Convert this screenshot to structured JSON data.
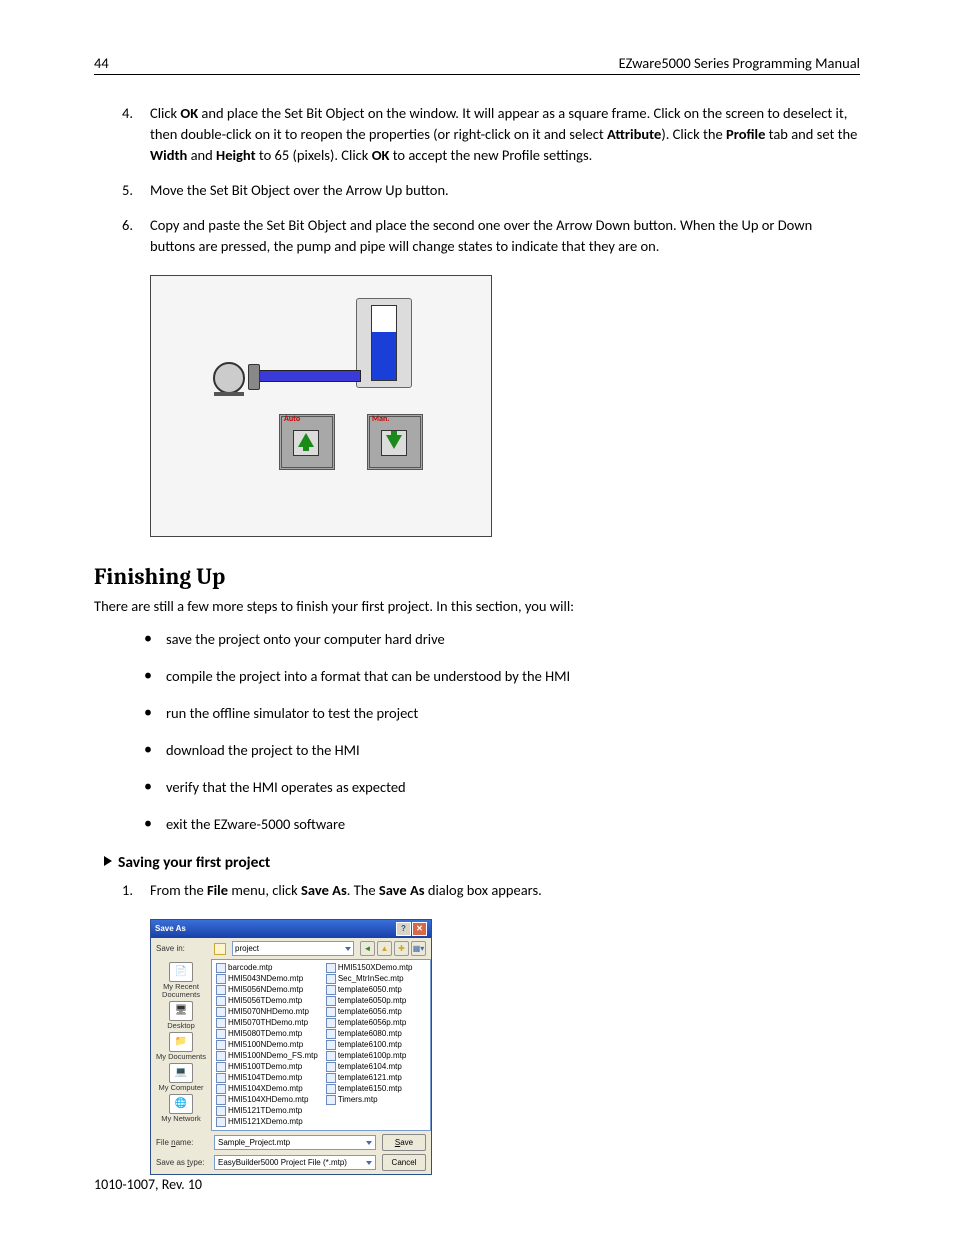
{
  "header": {
    "pageNo": "44",
    "title": "EZware5000 Series Programming Manual"
  },
  "steps": [
    {
      "n": "4.",
      "text_html": "Click <b>OK</b> and place the Set Bit Object on the window. It will appear as a square frame. Click on the screen to deselect it, then double-click on it to reopen the properties (or right-click on it and select <b>Attribute</b>). Click the <b>Profile</b> tab and set the <b>Width</b> and <b>Height</b> to 65 (pixels). Click <b>OK</b> to accept the new Profile settings."
    },
    {
      "n": "5.",
      "text_html": "Move the Set Bit Object over the Arrow Up button."
    },
    {
      "n": "6.",
      "text_html": "Copy and paste the Set Bit Object and place the second one over the Arrow Down button. When the Up or Down buttons are pressed, the pump and pipe will change states to indicate that they are on."
    }
  ],
  "diagram": {
    "btnUpLabel": "Auto",
    "btnDownLabel": "Man."
  },
  "sectionTitle": "Finishing Up",
  "lead": "There are still a few more steps to finish your first project. In this section, you will:",
  "bullets": [
    "save the project onto your computer hard drive",
    "compile the project into a format that can be understood by the HMI",
    "run the offline simulator to test the project",
    "download the project to the HMI",
    "verify that the HMI operates as expected",
    "exit the EZware-5000 software"
  ],
  "subheading": "Saving your first project",
  "savingSteps": [
    {
      "n": "1.",
      "text_html": "From the <b>File</b> menu, click <b>Save As</b>. The <b>Save As</b> dialog box appears."
    }
  ],
  "dialog": {
    "title": "Save As",
    "saveInLabel": "Save in:",
    "saveInValue": "project",
    "places": [
      {
        "label": "My Recent Documents",
        "glyph": "📄"
      },
      {
        "label": "Desktop",
        "glyph": "🖥"
      },
      {
        "label": "My Documents",
        "glyph": "📁"
      },
      {
        "label": "My Computer",
        "glyph": "💻"
      },
      {
        "label": "My Network",
        "glyph": "🌐"
      }
    ],
    "filesCol1": [
      "barcode.mtp",
      "HMI5043NDemo.mtp",
      "HMI5056NDemo.mtp",
      "HMI5056TDemo.mtp",
      "HMI5070NHDemo.mtp",
      "HMI5070THDemo.mtp",
      "HMI5080TDemo.mtp",
      "HMI5100NDemo.mtp",
      "HMI5100NDemo_FS.mtp",
      "HMI5100TDemo.mtp",
      "HMI5104TDemo.mtp",
      "HMI5104XDemo.mtp",
      "HMI5104XHDemo.mtp",
      "HMI5121TDemo.mtp",
      "HMI5121XDemo.mtp"
    ],
    "filesCol2": [
      "HMI5150XDemo.mtp",
      "Sec_MtrInSec.mtp",
      "template6050.mtp",
      "template6050p.mtp",
      "template6056.mtp",
      "template6056p.mtp",
      "template6080.mtp",
      "template6100.mtp",
      "template6100p.mtp",
      "template6104.mtp",
      "template6121.mtp",
      "template6150.mtp",
      "Timers.mtp"
    ],
    "fileNameLabel": "File name:",
    "fileNameValue": "Sample_Project.mtp",
    "saveTypeLabel": "Save as type:",
    "saveTypeValue": "EasyBuilder5000 Project File (*.mtp)",
    "saveBtn": "Save",
    "cancelBtn": "Cancel"
  },
  "footer": "1010-1007, Rev. 10"
}
